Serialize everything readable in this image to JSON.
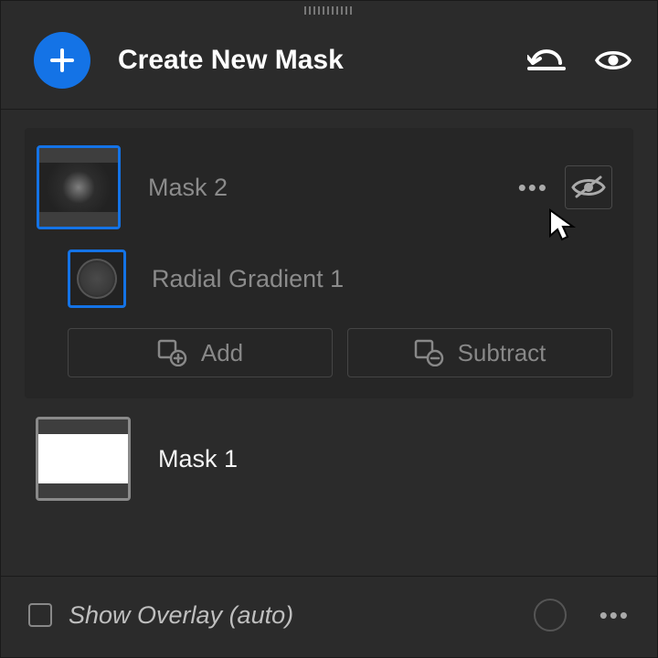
{
  "header": {
    "title": "Create New Mask"
  },
  "masks": [
    {
      "label": "Mask 2",
      "selected": true,
      "hidden": true,
      "component": {
        "label": "Radial Gradient 1"
      }
    },
    {
      "label": "Mask 1",
      "selected": false,
      "hidden": false
    }
  ],
  "bool": {
    "add_label": "Add",
    "subtract_label": "Subtract"
  },
  "footer": {
    "label": "Show Overlay (auto)",
    "checked": false
  },
  "colors": {
    "accent": "#1473e6"
  }
}
